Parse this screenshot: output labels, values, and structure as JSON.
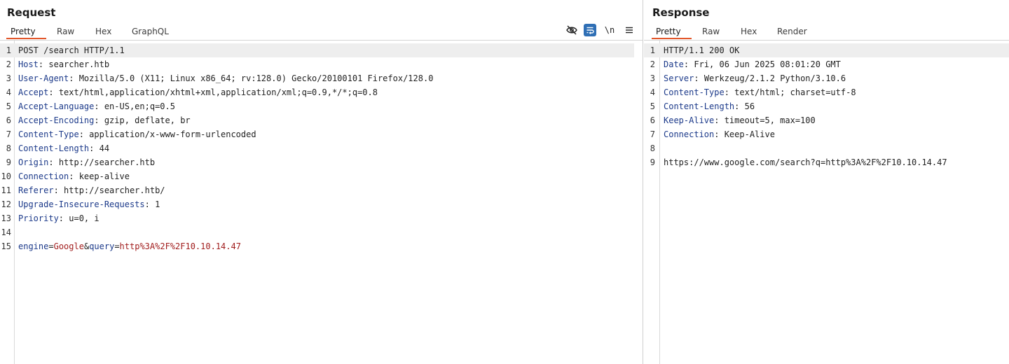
{
  "request": {
    "title": "Request",
    "tabs": [
      "Pretty",
      "Raw",
      "Hex",
      "GraphQL"
    ],
    "active_tab": "Pretty",
    "toolbar": {
      "hide_icon": "eye-off-icon",
      "wrap_icon": "wrap-lines-icon",
      "newline_label": "\\n",
      "menu_icon": "hamburger-menu-icon"
    },
    "lines": [
      {
        "n": "1",
        "text": "POST /search HTTP/1.1"
      },
      {
        "n": "2",
        "key": "Host",
        "value": " searcher.htb"
      },
      {
        "n": "3",
        "key": "User-Agent",
        "value": " Mozilla/5.0 (X11; Linux x86_64; rv:128.0) Gecko/20100101 Firefox/128.0"
      },
      {
        "n": "4",
        "key": "Accept",
        "value": " text/html,application/xhtml+xml,application/xml;q=0.9,*/*;q=0.8"
      },
      {
        "n": "5",
        "key": "Accept-Language",
        "value": " en-US,en;q=0.5"
      },
      {
        "n": "6",
        "key": "Accept-Encoding",
        "value": " gzip, deflate, br"
      },
      {
        "n": "7",
        "key": "Content-Type",
        "value": " application/x-www-form-urlencoded"
      },
      {
        "n": "8",
        "key": "Content-Length",
        "value": " 44"
      },
      {
        "n": "9",
        "key": "Origin",
        "value": " http://searcher.htb"
      },
      {
        "n": "10",
        "key": "Connection",
        "value": " keep-alive"
      },
      {
        "n": "11",
        "key": "Referer",
        "value": " http://searcher.htb/"
      },
      {
        "n": "12",
        "key": "Upgrade-Insecure-Requests",
        "value": " 1"
      },
      {
        "n": "13",
        "key": "Priority",
        "value": " u=0, i"
      },
      {
        "n": "14",
        "text": ""
      },
      {
        "n": "15",
        "params": [
          {
            "k": "engine",
            "v": "Google"
          },
          {
            "k": "query",
            "v": "http%3A%2F%2F10.10.14.47"
          }
        ]
      }
    ]
  },
  "response": {
    "title": "Response",
    "tabs": [
      "Pretty",
      "Raw",
      "Hex",
      "Render"
    ],
    "active_tab": "Pretty",
    "lines": [
      {
        "n": "1",
        "text": "HTTP/1.1 200 OK"
      },
      {
        "n": "2",
        "key": "Date",
        "value": " Fri, 06 Jun 2025 08:01:20 GMT"
      },
      {
        "n": "3",
        "key": "Server",
        "value": " Werkzeug/2.1.2 Python/3.10.6"
      },
      {
        "n": "4",
        "key": "Content-Type",
        "value": " text/html; charset=utf-8"
      },
      {
        "n": "5",
        "key": "Content-Length",
        "value": " 56"
      },
      {
        "n": "6",
        "key": "Keep-Alive",
        "value": " timeout=5, max=100"
      },
      {
        "n": "7",
        "key": "Connection",
        "value": " Keep-Alive"
      },
      {
        "n": "8",
        "text": ""
      },
      {
        "n": "9",
        "text": "https://www.google.com/search?q=http%3A%2F%2F10.10.14.47"
      }
    ]
  },
  "colors": {
    "accent": "#e3572b",
    "header_key": "#1c3a8a",
    "param_value": "#a11d1d",
    "wrap_button_bg": "#2f6fb5"
  }
}
